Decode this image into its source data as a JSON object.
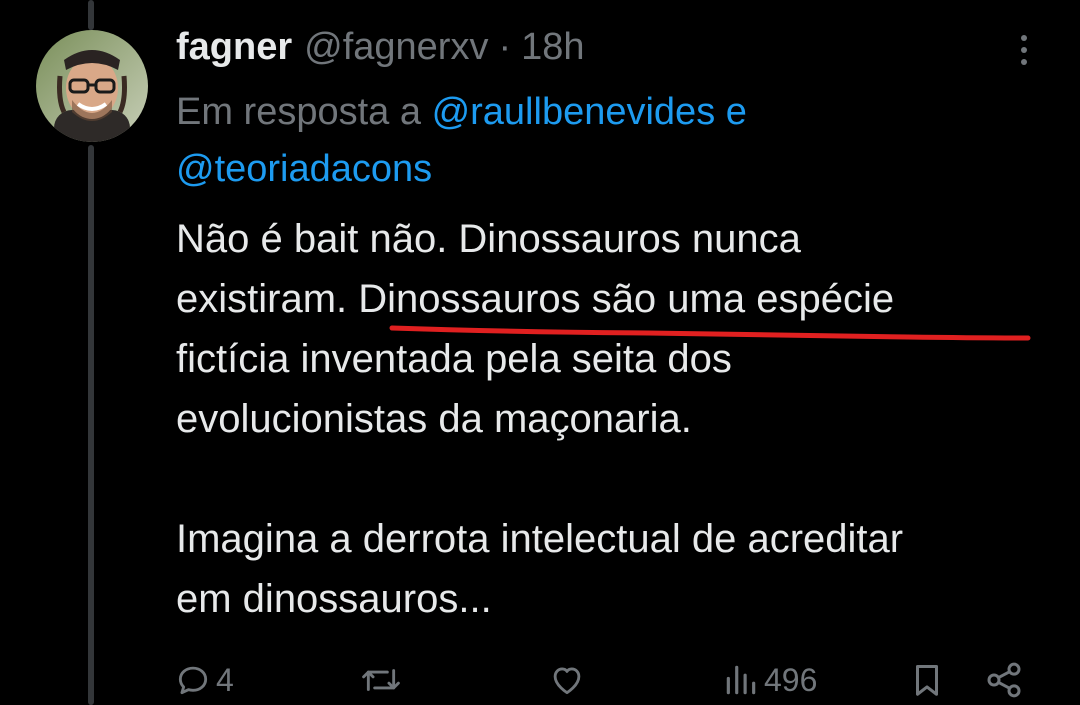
{
  "tweet": {
    "author_name": "fagner",
    "author_handle": "@fagnerxv",
    "separator": "·",
    "timestamp": "18h",
    "reply_prefix": "Em resposta a ",
    "reply_mention_1": "@raullbenevides",
    "reply_conjunction": " e",
    "reply_mention_2": "@teoriadacons",
    "body_line_1": "Não é bait não. Dinossauros nunca",
    "body_line_2_a": "existiram. ",
    "body_line_2_b": "Dinossauros são uma espécie",
    "body_line_3": "fictícia inventada pela seita dos",
    "body_line_4": "evolucionistas da maçonaria.",
    "body_line_5": "Imagina a derrota intelectual de acreditar",
    "body_line_6": "em dinossauros..."
  },
  "actions": {
    "reply_count": "4",
    "repost_count": "",
    "like_count": "",
    "view_count": "496"
  },
  "icons": {
    "more": "more-vertical-icon",
    "reply": "reply-icon",
    "repost": "repost-icon",
    "like": "heart-icon",
    "views": "views-bar-chart-icon",
    "bookmark": "bookmark-icon",
    "share": "share-icon"
  },
  "colors": {
    "background": "#000000",
    "text_primary": "#e7e9ea",
    "text_secondary": "#71767b",
    "mention_blue": "#1d9bf0",
    "underline_red": "#e02020"
  }
}
